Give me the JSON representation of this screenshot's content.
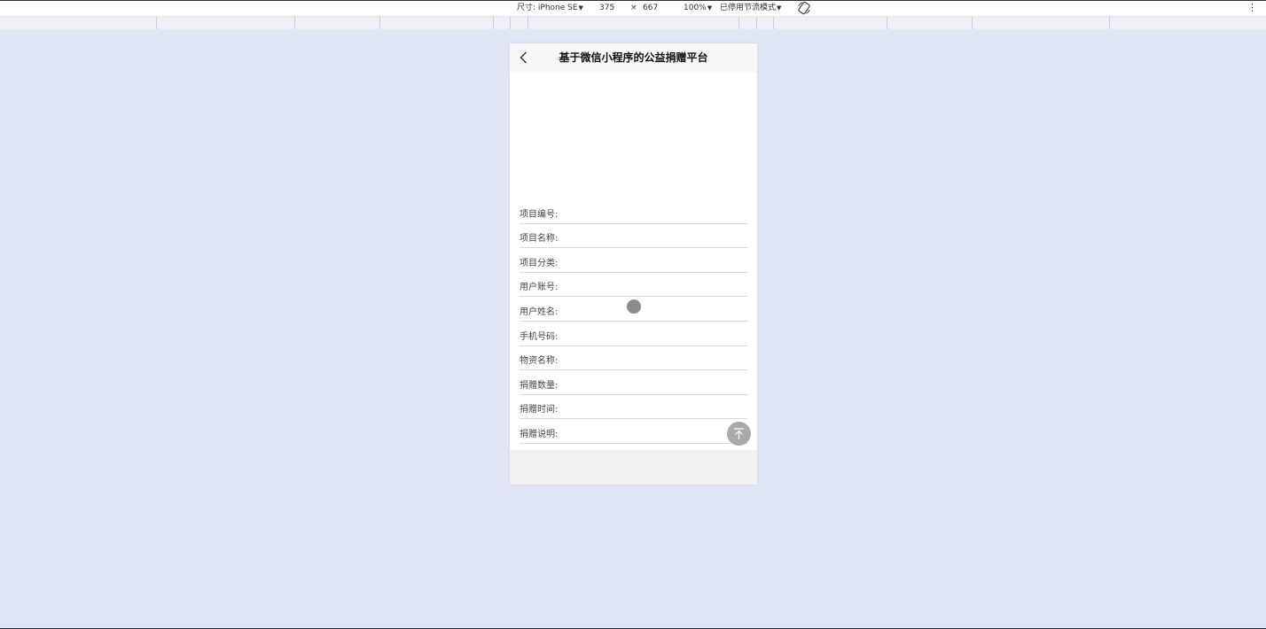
{
  "toolbar": {
    "size_label": "尺寸: iPhone SE",
    "width": "375",
    "times": "×",
    "height": "667",
    "zoom": "100%",
    "throttle": "已停用节流模式"
  },
  "nav": {
    "title": "基于微信小程序的公益捐赠平台"
  },
  "form": {
    "fields": [
      {
        "label": "项目编号:",
        "value": ""
      },
      {
        "label": "项目名称:",
        "value": ""
      },
      {
        "label": "项目分类:",
        "value": ""
      },
      {
        "label": "用户账号:",
        "value": ""
      },
      {
        "label": "用户姓名:",
        "value": ""
      },
      {
        "label": "手机号码:",
        "value": ""
      },
      {
        "label": "物资名称:",
        "value": ""
      },
      {
        "label": "捐赠数量:",
        "value": ""
      },
      {
        "label": "捐赠时间:",
        "value": ""
      },
      {
        "label": "捐赠说明:",
        "value": ""
      }
    ]
  },
  "icons": {
    "back": "chevron-left-icon",
    "top": "back-to-top-icon",
    "rotate": "rotate-device-icon",
    "more": "more-vertical-icon"
  },
  "colors": {
    "page_bg": "#e0e6f3",
    "nav_bg": "#f8f8f8",
    "footer_bg": "#f1f1f1",
    "top_button": "#a9a9a9"
  }
}
